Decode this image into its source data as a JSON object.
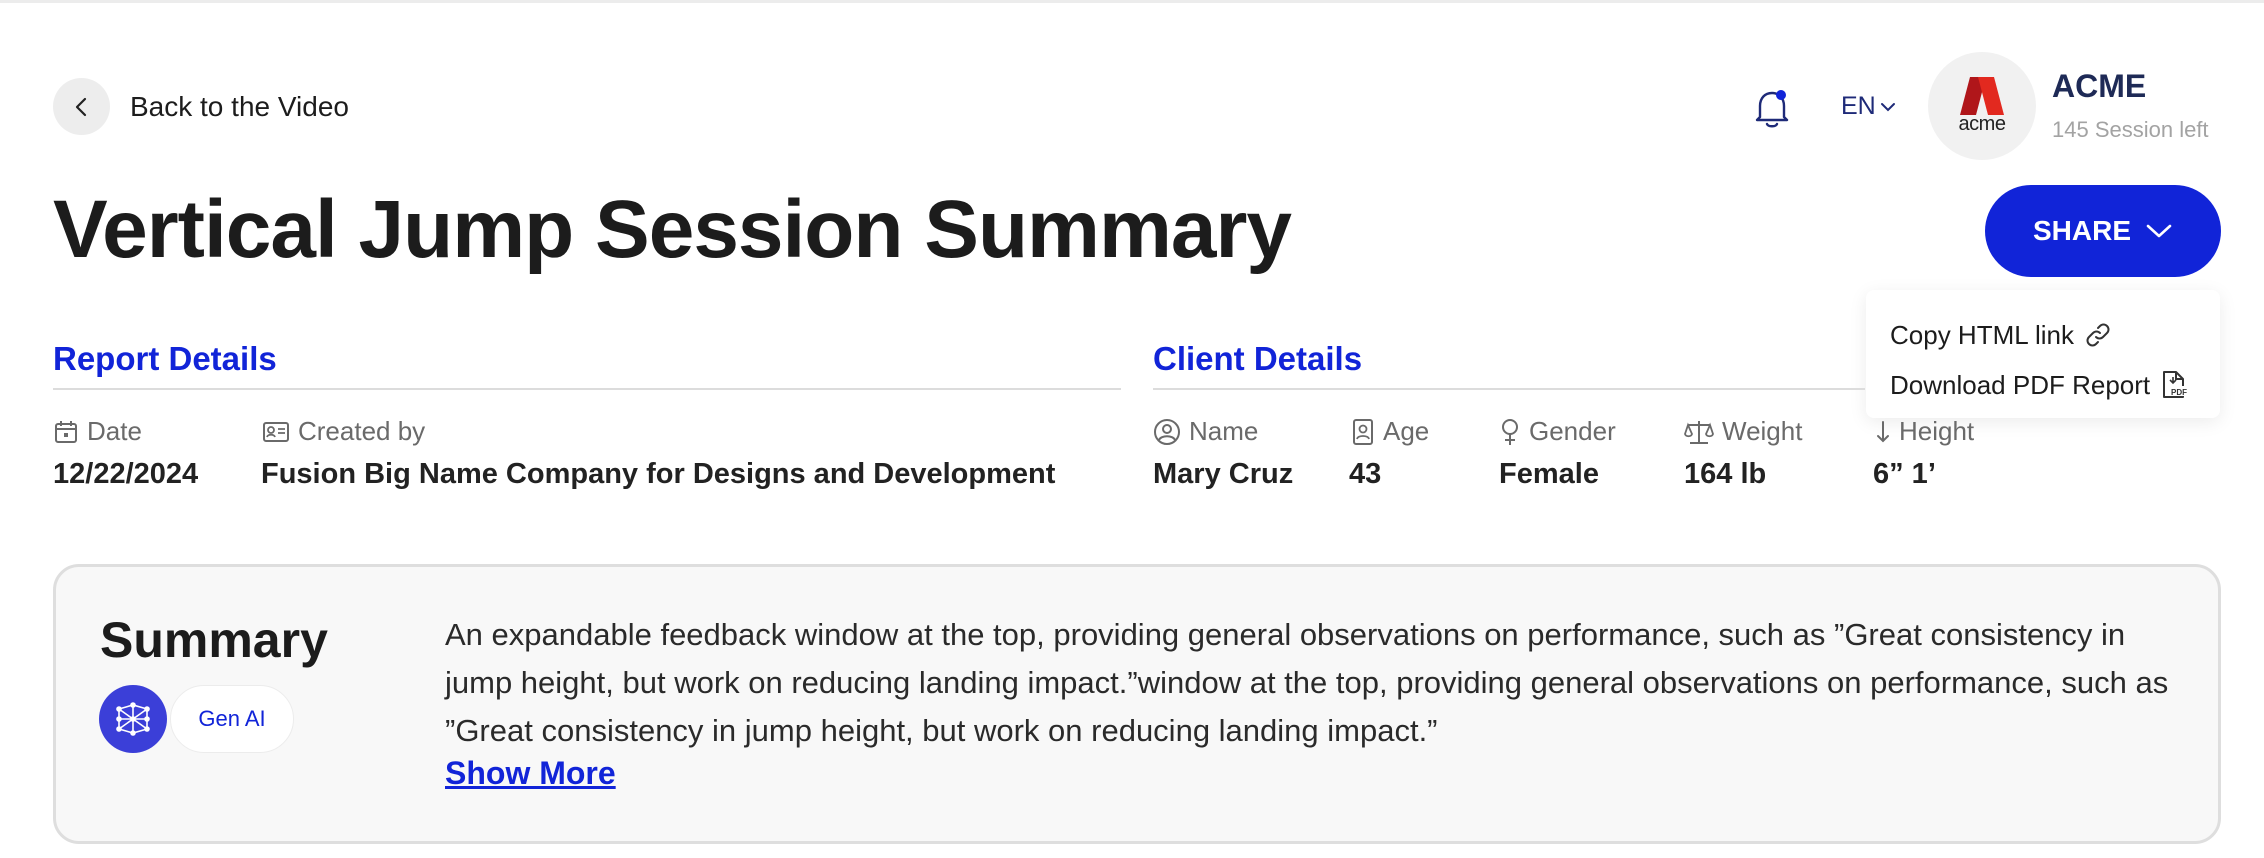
{
  "header": {
    "back_label": "Back to the Video",
    "language": "EN",
    "org_logo_text": "acme",
    "org_name": "ACME",
    "sessions_left": "145 Session left"
  },
  "page_title": "Vertical Jump Session Summary",
  "share": {
    "label": "SHARE",
    "menu": [
      {
        "label": "Copy HTML link",
        "icon": "link-icon"
      },
      {
        "label": "Download PDF Report",
        "icon": "pdf-file-icon"
      }
    ]
  },
  "report_details": {
    "heading": "Report Details",
    "date_label": "Date",
    "date_value": "12/22/2024",
    "created_by_label": "Created by",
    "created_by_value": "Fusion Big Name Company for Designs and Development"
  },
  "client_details": {
    "heading": "Client Details",
    "name_label": "Name",
    "name_value": "Mary Cruz",
    "age_label": "Age",
    "age_value": "43",
    "gender_label": "Gender",
    "gender_value": "Female",
    "weight_label": "Weight",
    "weight_value": "164 lb",
    "height_label": "Height",
    "height_value": "6” 1’"
  },
  "summary": {
    "title": "Summary",
    "badge": "Gen AI",
    "text": "An expandable feedback window at the top, providing general observations on performance, such as ”Great consistency in jump height, but work on reducing landing impact.”window at the top, providing general observations on performance, such as ”Great consistency in jump height, but work on reducing landing impact.”",
    "show_more": "Show More"
  },
  "colors": {
    "accent": "#1124d8",
    "org_name": "#1e2a56",
    "logo_red": "#d3241c"
  }
}
